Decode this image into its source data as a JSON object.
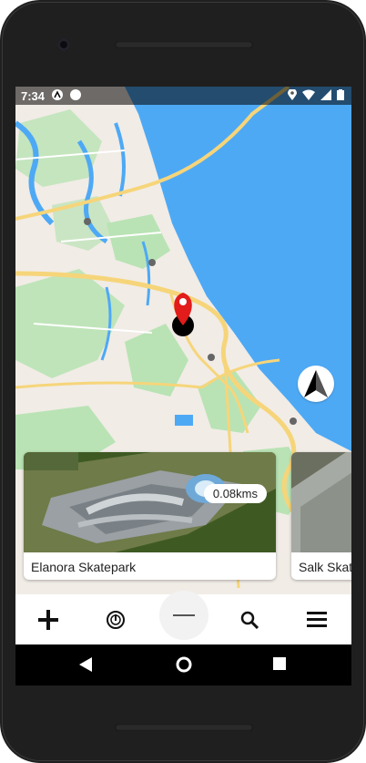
{
  "status_bar": {
    "time": "7:34"
  },
  "cards": [
    {
      "title": "Elanora Skatepark",
      "distance": "0.08kms"
    },
    {
      "title": "Salk Skat",
      "distance": ""
    }
  ],
  "icons": {
    "plus": "plus-icon",
    "stopwatch": "stopwatch-icon",
    "handle": "drag-handle-icon",
    "search": "search-icon",
    "menu": "menu-icon",
    "compass": "north-arrow-icon"
  },
  "colors": {
    "water": "#4ea9f5",
    "land": "#f1ece6",
    "green": "#b9e3b4",
    "road": "#f6d57a",
    "pin": "#e21b1b"
  }
}
